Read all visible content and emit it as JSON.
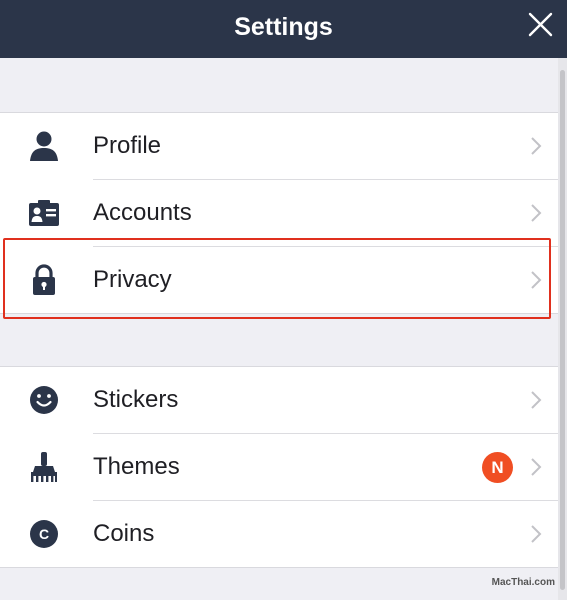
{
  "header": {
    "title": "Settings",
    "close_icon": "close-icon"
  },
  "sections": [
    {
      "items": [
        {
          "label": "Profile",
          "icon": "person-icon"
        },
        {
          "label": "Accounts",
          "icon": "id-card-icon"
        },
        {
          "label": "Privacy",
          "icon": "lock-icon",
          "highlighted": true
        }
      ]
    },
    {
      "items": [
        {
          "label": "Stickers",
          "icon": "smiley-icon"
        },
        {
          "label": "Themes",
          "icon": "brush-icon",
          "badge": "N"
        },
        {
          "label": "Coins",
          "icon": "coin-icon",
          "coin_letter": "C"
        }
      ]
    }
  ],
  "watermark": "MacThai.com",
  "colors": {
    "header_bg": "#2b3549",
    "icon": "#2b3549",
    "badge": "#f04e23",
    "highlight_border": "#e0301e",
    "background": "#efeff4"
  }
}
